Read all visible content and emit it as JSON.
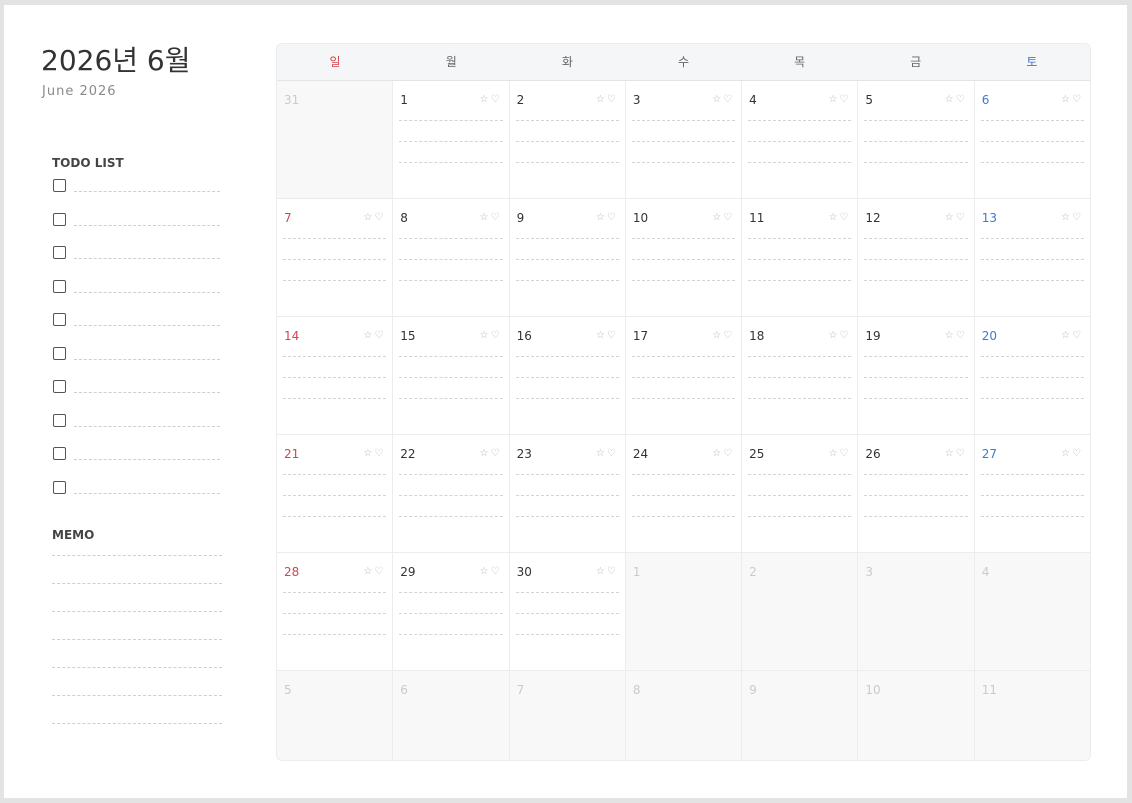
{
  "header": {
    "title": "2026년 6월",
    "subtitle": "June 2026"
  },
  "todo": {
    "label": "TODO LIST",
    "item_count": 10
  },
  "memo": {
    "label": "MEMO",
    "line_count": 7
  },
  "calendar": {
    "weekdays": [
      "일",
      "월",
      "화",
      "수",
      "목",
      "금",
      "토"
    ],
    "icons": {
      "star": "☆",
      "heart": "♡"
    },
    "colors": {
      "sunday": "#d6454f",
      "saturday": "#3a7bd5",
      "muted": "#cbcbcb"
    },
    "weeks": [
      [
        {
          "d": "31",
          "cur": false
        },
        {
          "d": "1",
          "cur": true
        },
        {
          "d": "2",
          "cur": true
        },
        {
          "d": "3",
          "cur": true
        },
        {
          "d": "4",
          "cur": true
        },
        {
          "d": "5",
          "cur": true
        },
        {
          "d": "6",
          "cur": true
        }
      ],
      [
        {
          "d": "7",
          "cur": true
        },
        {
          "d": "8",
          "cur": true
        },
        {
          "d": "9",
          "cur": true
        },
        {
          "d": "10",
          "cur": true
        },
        {
          "d": "11",
          "cur": true
        },
        {
          "d": "12",
          "cur": true
        },
        {
          "d": "13",
          "cur": true
        }
      ],
      [
        {
          "d": "14",
          "cur": true
        },
        {
          "d": "15",
          "cur": true
        },
        {
          "d": "16",
          "cur": true
        },
        {
          "d": "17",
          "cur": true
        },
        {
          "d": "18",
          "cur": true
        },
        {
          "d": "19",
          "cur": true
        },
        {
          "d": "20",
          "cur": true
        }
      ],
      [
        {
          "d": "21",
          "cur": true
        },
        {
          "d": "22",
          "cur": true
        },
        {
          "d": "23",
          "cur": true
        },
        {
          "d": "24",
          "cur": true
        },
        {
          "d": "25",
          "cur": true
        },
        {
          "d": "26",
          "cur": true
        },
        {
          "d": "27",
          "cur": true
        }
      ],
      [
        {
          "d": "28",
          "cur": true
        },
        {
          "d": "29",
          "cur": true
        },
        {
          "d": "30",
          "cur": true
        },
        {
          "d": "1",
          "cur": false
        },
        {
          "d": "2",
          "cur": false
        },
        {
          "d": "3",
          "cur": false
        },
        {
          "d": "4",
          "cur": false
        }
      ],
      [
        {
          "d": "5",
          "cur": false
        },
        {
          "d": "6",
          "cur": false
        },
        {
          "d": "7",
          "cur": false
        },
        {
          "d": "8",
          "cur": false
        },
        {
          "d": "9",
          "cur": false
        },
        {
          "d": "10",
          "cur": false
        },
        {
          "d": "11",
          "cur": false
        }
      ]
    ]
  }
}
